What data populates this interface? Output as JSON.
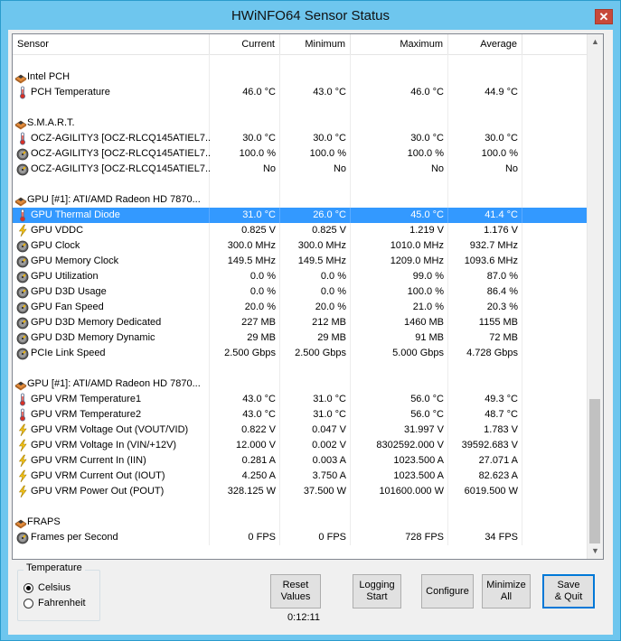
{
  "window": {
    "title": "HWiNFO64 Sensor Status",
    "close_glyph": "✕"
  },
  "columns": [
    "Sensor",
    "Current",
    "Minimum",
    "Maximum",
    "Average"
  ],
  "rows": [
    {
      "type": "blank"
    },
    {
      "type": "category",
      "icon": "chip-icon",
      "label": "Intel PCH"
    },
    {
      "type": "sensor",
      "icon": "thermometer-icon",
      "label": "PCH Temperature",
      "current": "46.0 °C",
      "minimum": "43.0 °C",
      "maximum": "46.0 °C",
      "average": "44.9 °C"
    },
    {
      "type": "blank"
    },
    {
      "type": "category",
      "icon": "chip-icon",
      "label": "S.M.A.R.T."
    },
    {
      "type": "sensor",
      "icon": "thermometer-icon",
      "label": "OCZ-AGILITY3 [OCZ-RLCQ145ATIEL7...",
      "current": "30.0 °C",
      "minimum": "30.0 °C",
      "maximum": "30.0 °C",
      "average": "30.0 °C"
    },
    {
      "type": "sensor",
      "icon": "gauge-icon",
      "label": "OCZ-AGILITY3 [OCZ-RLCQ145ATIEL7...",
      "current": "100.0 %",
      "minimum": "100.0 %",
      "maximum": "100.0 %",
      "average": "100.0 %"
    },
    {
      "type": "sensor",
      "icon": "gauge-icon",
      "label": "OCZ-AGILITY3 [OCZ-RLCQ145ATIEL7...",
      "current": "No",
      "minimum": "No",
      "maximum": "No",
      "average": "No"
    },
    {
      "type": "blank"
    },
    {
      "type": "category",
      "icon": "chip-icon",
      "label": "GPU [#1]: ATI/AMD Radeon HD 7870..."
    },
    {
      "type": "sensor",
      "icon": "thermometer-icon",
      "label": "GPU Thermal Diode",
      "current": "31.0 °C",
      "minimum": "26.0 °C",
      "maximum": "45.0 °C",
      "average": "41.4 °C",
      "selected": true
    },
    {
      "type": "sensor",
      "icon": "lightning-icon",
      "label": "GPU VDDC",
      "current": "0.825 V",
      "minimum": "0.825 V",
      "maximum": "1.219 V",
      "average": "1.176 V"
    },
    {
      "type": "sensor",
      "icon": "gauge-icon",
      "label": "GPU Clock",
      "current": "300.0 MHz",
      "minimum": "300.0 MHz",
      "maximum": "1010.0 MHz",
      "average": "932.7 MHz"
    },
    {
      "type": "sensor",
      "icon": "gauge-icon",
      "label": "GPU Memory Clock",
      "current": "149.5 MHz",
      "minimum": "149.5 MHz",
      "maximum": "1209.0 MHz",
      "average": "1093.6 MHz"
    },
    {
      "type": "sensor",
      "icon": "gauge-icon",
      "label": "GPU Utilization",
      "current": "0.0 %",
      "minimum": "0.0 %",
      "maximum": "99.0 %",
      "average": "87.0 %"
    },
    {
      "type": "sensor",
      "icon": "gauge-icon",
      "label": "GPU D3D Usage",
      "current": "0.0 %",
      "minimum": "0.0 %",
      "maximum": "100.0 %",
      "average": "86.4 %"
    },
    {
      "type": "sensor",
      "icon": "gauge-icon",
      "label": "GPU Fan Speed",
      "current": "20.0 %",
      "minimum": "20.0 %",
      "maximum": "21.0 %",
      "average": "20.3 %"
    },
    {
      "type": "sensor",
      "icon": "gauge-icon",
      "label": "GPU D3D Memory Dedicated",
      "current": "227 MB",
      "minimum": "212 MB",
      "maximum": "1460 MB",
      "average": "1155 MB"
    },
    {
      "type": "sensor",
      "icon": "gauge-icon",
      "label": "GPU D3D Memory Dynamic",
      "current": "29 MB",
      "minimum": "29 MB",
      "maximum": "91 MB",
      "average": "72 MB"
    },
    {
      "type": "sensor",
      "icon": "gauge-icon",
      "label": "PCIe Link Speed",
      "current": "2.500 Gbps",
      "minimum": "2.500 Gbps",
      "maximum": "5.000 Gbps",
      "average": "4.728 Gbps"
    },
    {
      "type": "blank"
    },
    {
      "type": "category",
      "icon": "chip-icon",
      "label": "GPU [#1]: ATI/AMD Radeon HD 7870..."
    },
    {
      "type": "sensor",
      "icon": "thermometer-icon",
      "label": "GPU VRM Temperature1",
      "current": "43.0 °C",
      "minimum": "31.0 °C",
      "maximum": "56.0 °C",
      "average": "49.3 °C"
    },
    {
      "type": "sensor",
      "icon": "thermometer-icon",
      "label": "GPU VRM Temperature2",
      "current": "43.0 °C",
      "minimum": "31.0 °C",
      "maximum": "56.0 °C",
      "average": "48.7 °C"
    },
    {
      "type": "sensor",
      "icon": "lightning-icon",
      "label": "GPU VRM Voltage Out (VOUT/VID)",
      "current": "0.822 V",
      "minimum": "0.047 V",
      "maximum": "31.997 V",
      "average": "1.783 V"
    },
    {
      "type": "sensor",
      "icon": "lightning-icon",
      "label": "GPU VRM Voltage In (VIN/+12V)",
      "current": "12.000 V",
      "minimum": "0.002 V",
      "maximum": "8302592.000 V",
      "average": "39592.683 V"
    },
    {
      "type": "sensor",
      "icon": "lightning-icon",
      "label": "GPU VRM Current In (IIN)",
      "current": "0.281 A",
      "minimum": "0.003 A",
      "maximum": "1023.500 A",
      "average": "27.071 A"
    },
    {
      "type": "sensor",
      "icon": "lightning-icon",
      "label": "GPU VRM Current Out (IOUT)",
      "current": "4.250 A",
      "minimum": "3.750 A",
      "maximum": "1023.500 A",
      "average": "82.623 A"
    },
    {
      "type": "sensor",
      "icon": "lightning-icon",
      "label": "GPU VRM Power Out (POUT)",
      "current": "328.125 W",
      "minimum": "37.500 W",
      "maximum": "101600.000 W",
      "average": "6019.500 W"
    },
    {
      "type": "blank"
    },
    {
      "type": "category",
      "icon": "chip-icon",
      "label": "FRAPS"
    },
    {
      "type": "sensor",
      "icon": "gauge-icon",
      "label": "Frames per Second",
      "current": "0 FPS",
      "minimum": "0 FPS",
      "maximum": "728 FPS",
      "average": "34 FPS"
    }
  ],
  "scrollbar": {
    "up_glyph": "▲",
    "down_glyph": "▼"
  },
  "temperature": {
    "title": "Temperature",
    "options": [
      {
        "label": "Celsius",
        "checked": true
      },
      {
        "label": "Fahrenheit",
        "checked": false
      }
    ]
  },
  "buttons": {
    "reset": "Reset\nValues",
    "logging": "Logging\nStart",
    "configure": "Configure",
    "minimize": "Minimize\nAll",
    "save_quit": "Save\n& Quit"
  },
  "timer": "0:12:11",
  "colors": {
    "selection": "#3399ff",
    "window_border": "#6ec6ee",
    "close": "#c7493a"
  }
}
